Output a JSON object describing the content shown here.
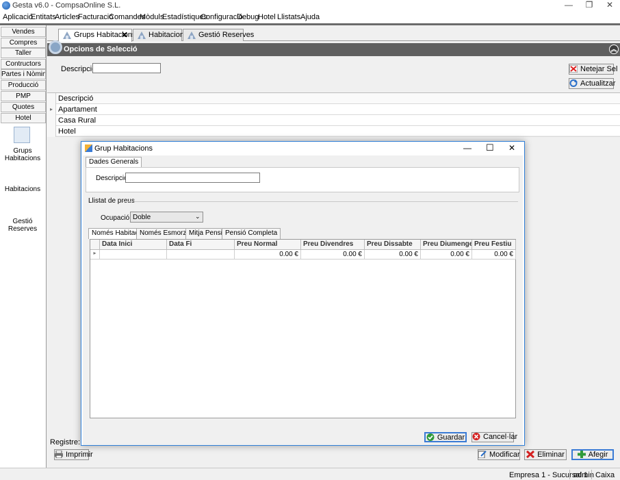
{
  "window": {
    "title": "Gesta v6.0 - CompsaOnline S.L.",
    "minimize": "—",
    "restore": "❐",
    "close": "✕"
  },
  "menu": [
    "Aplicació",
    "Entitats",
    "Articles",
    "Facturació",
    "Comandes",
    "Mòduls",
    "Estadístiques",
    "Configuració",
    "Debug",
    "Hotel",
    "Llistats",
    "Ajuda"
  ],
  "sidebar": {
    "buttons": [
      "Vendes",
      "Compres",
      "Taller",
      "Contructors",
      "Partes i Nòmin...",
      "Producció",
      "PMP",
      "Quotes",
      "Hotel"
    ],
    "items": [
      "Grups Habitacions",
      "Habitacions",
      "Gestió Reserves"
    ]
  },
  "tabs": [
    {
      "label": "Grups Habitacions",
      "close": "✕"
    },
    {
      "label": "Habitacions"
    },
    {
      "label": "Gestió Reserves"
    }
  ],
  "selection": {
    "header": "Opcions de Selecció",
    "description_label": "Descripció:",
    "description_value": "",
    "clear_button": "Netejar Sel",
    "refresh_button": "Actualitzar"
  },
  "grid": {
    "column": "Descripció",
    "rows": [
      "Apartament",
      "Casa Rural",
      "Hotel"
    ]
  },
  "bottom": {
    "records_label": "Registre:",
    "print_button": "Imprimir",
    "modify_button": "Modificar",
    "delete_button": "Eliminar",
    "add_button": "Afegir"
  },
  "status": {
    "company": "Empresa 1 - Sucursal 1",
    "user": "admin",
    "module": "Caixa"
  },
  "dialog": {
    "title": "Grup Habitacions",
    "minimize": "—",
    "maximize": "☐",
    "close": "✕",
    "general_tab": "Dades Generals",
    "description_label": "Descripció:",
    "description_value": "",
    "price_list_label": "Llistat de preus",
    "occupation_label": "Ocupació:",
    "occupation_value": "Doble",
    "rate_tabs": [
      "Només Habitació",
      "Només Esmorzar",
      "Mitja Pensió",
      "Pensió Completa"
    ],
    "columns": [
      "Data Inici",
      "Data Fi",
      "Preu Normal",
      "Preu Divendres",
      "Preu Dissabte",
      "Preu Diumenge",
      "Preu Festiu"
    ],
    "row": [
      "",
      "",
      "0.00 €",
      "0.00 €",
      "0.00 €",
      "0.00 €",
      "0.00 €"
    ],
    "save_button": "Guardar",
    "cancel_button": "Cancel·lar"
  },
  "colors": {
    "header_bg": "#5f5f5f",
    "dialog_border": "#2f7fd8",
    "add_button_border": "#3a7bd5"
  }
}
